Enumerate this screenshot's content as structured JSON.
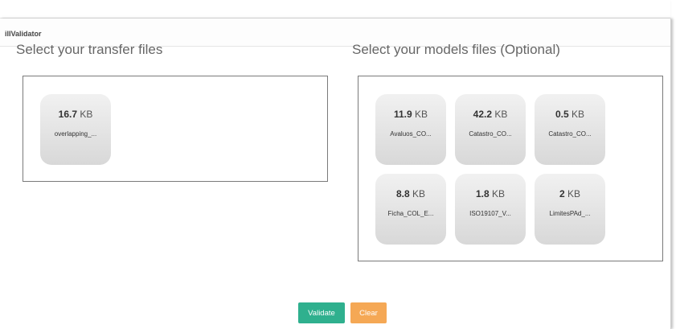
{
  "app": {
    "title": "ilIValidator"
  },
  "transfer": {
    "title": "Select your transfer files",
    "files": [
      {
        "size_value": "16.7",
        "size_unit": "KB",
        "name": "overlapping_..."
      }
    ]
  },
  "models": {
    "title": "Select your models files (Optional)",
    "files": [
      {
        "size_value": "11.9",
        "size_unit": "KB",
        "name": "Avaluos_CO..."
      },
      {
        "size_value": "42.2",
        "size_unit": "KB",
        "name": "Catastro_CO..."
      },
      {
        "size_value": "0.5",
        "size_unit": "KB",
        "name": "Catastro_CO..."
      },
      {
        "size_value": "8.8",
        "size_unit": "KB",
        "name": "Ficha_COL_E..."
      },
      {
        "size_value": "1.8",
        "size_unit": "KB",
        "name": "ISO19107_V..."
      },
      {
        "size_value": "2",
        "size_unit": "KB",
        "name": "LimitesPAd_..."
      }
    ]
  },
  "actions": {
    "validate_label": "Validate",
    "clear_label": "Clear",
    "validate_color": "#2fb08e",
    "clear_color": "#f5a855"
  }
}
